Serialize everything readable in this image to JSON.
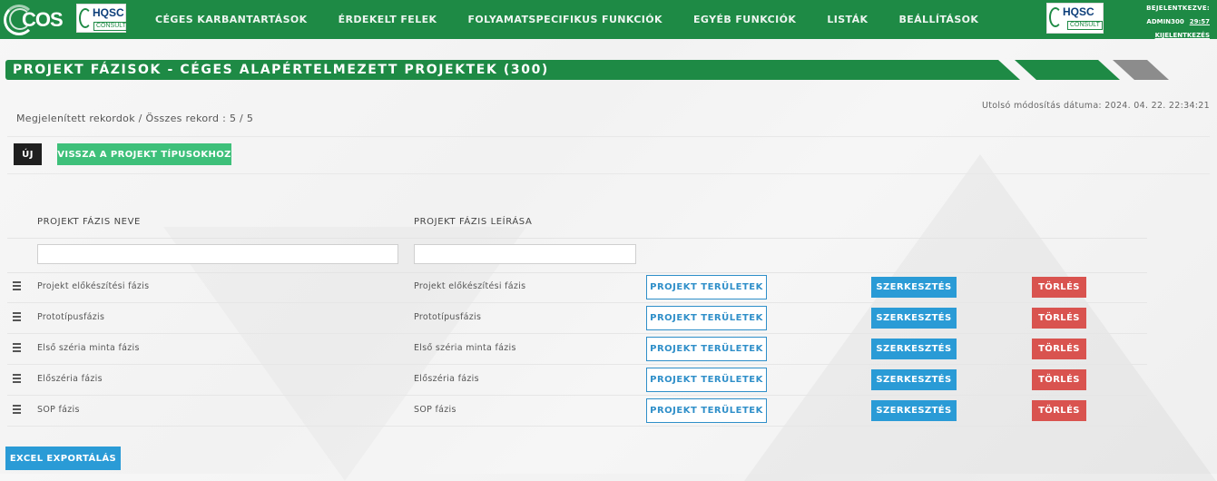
{
  "navbar": {
    "logo_text": "COS",
    "hqsc_logo_text": "HQSC",
    "hqsc_logo_sub": "CONSULT",
    "menu": [
      "CÉGES KARBANTARTÁSOK",
      "ÉRDEKELT FELEK",
      "FOLYAMATSPECIFIKUS FUNKCIÓK",
      "EGYÉB FUNKCIÓK",
      "LISTÁK",
      "BEÁLLÍTÁSOK"
    ],
    "logged_in_label": "BEJELENTKEZVE:",
    "username": "ADMIN300",
    "session_timer": "29:57",
    "logout_label": "KIJELENTKEZÉS"
  },
  "page": {
    "title": "PROJEKT FÁZISOK - CÉGES ALAPÉRTELMEZETT PROJEKTEK (300)",
    "last_modified": "Utolsó módosítás dátuma: 2024. 04. 22. 22:34:21",
    "record_count": "Megjelenített rekordok / Összes rekord : 5 / 5"
  },
  "actions": {
    "new_label": "ÚJ",
    "back_label": "VISSZA A PROJEKT TÍPUSOKHOZ"
  },
  "table": {
    "headers": {
      "name": "PROJEKT FÁZIS NEVE",
      "description": "PROJEKT FÁZIS LEÍRÁSA"
    },
    "filters": {
      "name_value": "",
      "description_value": ""
    },
    "row_buttons": {
      "areas": "PROJEKT TERÜLETEK",
      "edit": "SZERKESZTÉS",
      "delete": "TÖRLÉS"
    },
    "rows": [
      {
        "name": "Projekt előkészítési fázis",
        "description": "Projekt előkészítési fázis"
      },
      {
        "name": "Prototípusfázis",
        "description": "Prototípusfázis"
      },
      {
        "name": "Első széria minta fázis",
        "description": "Első széria minta fázis"
      },
      {
        "name": "Előszéria fázis",
        "description": "Előszéria fázis"
      },
      {
        "name": "SOP fázis",
        "description": "SOP fázis"
      }
    ]
  },
  "footer": {
    "excel_label": "EXCEL EXPORTÁLÁS"
  },
  "colors": {
    "brand_green": "#1e8a45",
    "accent_green": "#3ec07a",
    "blue": "#2a9bd6",
    "red": "#d9534f",
    "grey_stripe": "#8c8c8c"
  }
}
